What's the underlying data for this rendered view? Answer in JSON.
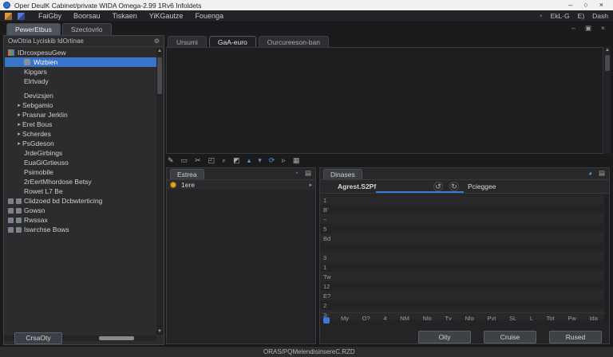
{
  "colors": {
    "accent": "#3b78d8",
    "selection": "#3a74c9",
    "yellow_dot": "#dfa528",
    "titlebar_bg": "#f1f1f1"
  },
  "window": {
    "title": "Oper DeulK Cabinet/private WIDA Omega-2.99 1Rv6 Infoldets",
    "minimize": "–",
    "maximize": "○",
    "close": "×"
  },
  "menubar": {
    "items": [
      {
        "label": "FaiGby"
      },
      {
        "label": "Boorsau"
      },
      {
        "label": "Tiskaen"
      },
      {
        "label": "YiKGautze"
      },
      {
        "label": "Fouenga"
      }
    ],
    "right_glyph": "◔",
    "right_items": [
      {
        "label": "EkL·G"
      },
      {
        "label": "E)"
      },
      {
        "label": "Dash"
      }
    ]
  },
  "left_panel": {
    "tabs": [
      {
        "label": "PewerEtbus",
        "active": true
      },
      {
        "label": "Szectovrlo",
        "active": false
      }
    ],
    "header": {
      "label": "OwOtria Lyciskib IdOrtinae",
      "icon": "⚙"
    },
    "tree": [
      {
        "label": "IDrcoxpesuGew",
        "indent": 0,
        "icon": "grid",
        "arrow": false,
        "selected": false,
        "dbl": false
      },
      {
        "label": "Wizbien",
        "indent": 2,
        "icon": "plain",
        "arrow": false,
        "selected": true,
        "dbl": false
      },
      {
        "label": "Kipgars",
        "indent": 2,
        "icon": "none",
        "arrow": false,
        "selected": false,
        "dbl": false
      },
      {
        "label": "Elrtvady",
        "indent": 2,
        "icon": "none",
        "arrow": false,
        "selected": false,
        "dbl": false
      },
      {
        "label": "",
        "indent": 0,
        "icon": "none",
        "arrow": false,
        "selected": false,
        "dbl": false,
        "spacer": true
      },
      {
        "label": "Devizsjen",
        "indent": 2,
        "icon": "none",
        "arrow": false,
        "selected": false,
        "dbl": false
      },
      {
        "label": "Sebgamio",
        "indent": 1,
        "icon": "none",
        "arrow": true,
        "selected": false,
        "dbl": false
      },
      {
        "label": "Prasnar Jerklin",
        "indent": 1,
        "icon": "none",
        "arrow": true,
        "selected": false,
        "dbl": false
      },
      {
        "label": "Eret Bous",
        "indent": 1,
        "icon": "none",
        "arrow": true,
        "selected": false,
        "dbl": false
      },
      {
        "label": "Scherdes",
        "indent": 1,
        "icon": "none",
        "arrow": true,
        "selected": false,
        "dbl": false
      },
      {
        "label": "PsGdeson",
        "indent": 1,
        "icon": "none",
        "arrow": true,
        "selected": false,
        "dbl": false
      },
      {
        "label": "JrdeGirbings",
        "indent": 2,
        "icon": "none",
        "arrow": false,
        "selected": false,
        "dbl": false
      },
      {
        "label": "EuaGiGrtieuso",
        "indent": 2,
        "icon": "none",
        "arrow": false,
        "selected": false,
        "dbl": false
      },
      {
        "label": "Psimobile",
        "indent": 2,
        "icon": "none",
        "arrow": false,
        "selected": false,
        "dbl": false
      },
      {
        "label": "2rEertMhordose Betsy",
        "indent": 2,
        "icon": "none",
        "arrow": false,
        "selected": false,
        "dbl": false
      },
      {
        "label": "Rowet L7 Be",
        "indent": 2,
        "icon": "none",
        "arrow": false,
        "selected": false,
        "dbl": false
      },
      {
        "label": "Clidzoed bd Dcbwterticing",
        "indent": 0,
        "icon": "none",
        "arrow": false,
        "selected": false,
        "dbl": true
      },
      {
        "label": "Gowsn",
        "indent": 0,
        "icon": "none",
        "arrow": false,
        "selected": false,
        "dbl": true
      },
      {
        "label": "Rwssax",
        "indent": 0,
        "icon": "none",
        "arrow": false,
        "selected": false,
        "dbl": true
      },
      {
        "label": "Iswrchse Bows",
        "indent": 0,
        "icon": "none",
        "arrow": false,
        "selected": false,
        "dbl": true
      }
    ],
    "create_button": "CrsaOty"
  },
  "main": {
    "mdi_controls": {
      "minimize": "–",
      "restore": "▣",
      "close": "×"
    },
    "tabs": [
      {
        "label": "Ursumi",
        "active": false
      },
      {
        "label": "GaA-euro",
        "active": true
      },
      {
        "label": "Ourcureeson-ban",
        "active": false
      }
    ],
    "toolbar_icons": [
      {
        "name": "edit-icon",
        "glyph": "✎",
        "color": "#b9b9b9"
      },
      {
        "name": "copy-icon",
        "glyph": "▭",
        "color": "#a9a9a9"
      },
      {
        "name": "cut-icon",
        "glyph": "✂",
        "color": "#a9a9a9"
      },
      {
        "name": "paste-icon",
        "glyph": "◰",
        "color": "#a9a9a9"
      },
      {
        "name": "search-icon",
        "glyph": "⌕",
        "color": "#a9a9a9"
      },
      {
        "name": "layout-icon",
        "glyph": "◩",
        "color": "#a9a9a9"
      },
      {
        "name": "sort-asc-icon",
        "glyph": "▴",
        "color": "#5a8fd6"
      },
      {
        "name": "sort-desc-icon",
        "glyph": "▾",
        "color": "#5a8fd6"
      },
      {
        "name": "refresh-icon",
        "glyph": "⟳",
        "color": "#5a8fd6"
      },
      {
        "name": "play-icon",
        "glyph": "▹",
        "color": "#a9a9a9"
      },
      {
        "name": "table-icon",
        "glyph": "▦",
        "color": "#a9a9a9"
      }
    ]
  },
  "elements_panel": {
    "tab": "Estrea",
    "icons": [
      {
        "name": "globe-icon",
        "glyph": "◔",
        "color": "#4f8fe0"
      },
      {
        "name": "list-icon",
        "glyph": "▤",
        "color": "#a9a9a9"
      }
    ],
    "items": [
      {
        "label": "1ere",
        "right_icon": "▸"
      }
    ]
  },
  "compare_panel": {
    "tab": "Dinases",
    "icons": [
      {
        "name": "globe-icon",
        "glyph": "◕",
        "color": "#4f8fe0"
      },
      {
        "name": "grid-icon",
        "glyph": "▤",
        "color": "#a9a9a9"
      }
    ],
    "left_column": "Agrest.S2Pf",
    "right_column": "Pcieggee",
    "swap_icons": [
      {
        "name": "rotate-left-icon",
        "glyph": "↺"
      },
      {
        "name": "rotate-right-icon",
        "glyph": "↻"
      }
    ],
    "rows": [
      "1",
      "B’",
      "~",
      "5",
      "Bd",
      "",
      "3",
      "1",
      "Tw",
      "12",
      "E?",
      "2",
      "3-"
    ],
    "footer_labels": [
      "My",
      "O?",
      "4",
      "NM",
      "Nlo",
      "Tv",
      "Nlo",
      "Pvt",
      "SL",
      "L",
      "Tot",
      "Pw",
      "Ida"
    ]
  },
  "dialog_buttons": {
    "ok": "Oity",
    "cancel": "Cruise",
    "reset": "Rused"
  },
  "statusbar": {
    "text": "ORAS/PQMelendisinsereC.RZD"
  }
}
